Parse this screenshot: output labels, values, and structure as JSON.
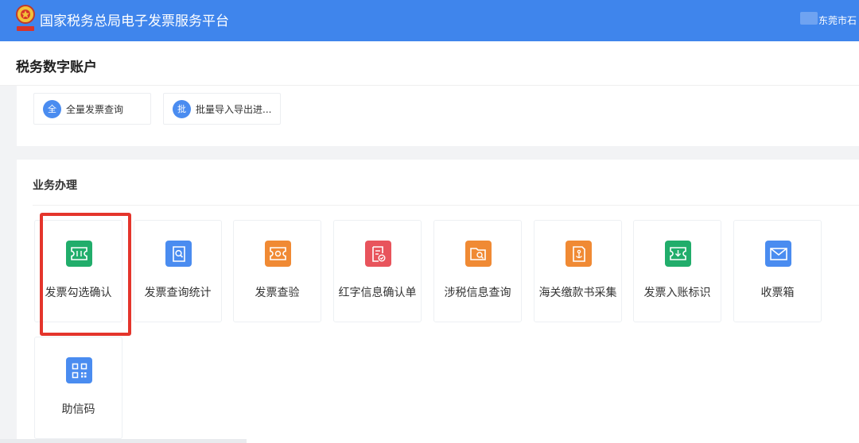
{
  "header": {
    "title": "国家税务总局电子发票服务平台",
    "user_area": "东莞市石"
  },
  "page": {
    "title": "税务数字账户"
  },
  "quick_actions": [
    {
      "badge": "全",
      "label": "全量发票查询"
    },
    {
      "badge": "批",
      "label": "批量导入导出进..."
    }
  ],
  "business": {
    "title": "业务办理",
    "tiles": [
      {
        "label": "发票勾选确认",
        "icon": "ticket-check-icon",
        "color": "#21ad6b",
        "highlighted": true
      },
      {
        "label": "发票查询统计",
        "icon": "search-doc-icon",
        "color": "#4a8cf0"
      },
      {
        "label": "发票查验",
        "icon": "ticket-icon",
        "color": "#f08a34"
      },
      {
        "label": "红字信息确认单",
        "icon": "doc-check-icon",
        "color": "#e8545c"
      },
      {
        "label": "涉税信息查询",
        "icon": "folder-search-icon",
        "color": "#f08a34"
      },
      {
        "label": "海关缴款书采集",
        "icon": "doc-anchor-icon",
        "color": "#f08a34"
      },
      {
        "label": "发票入账标识",
        "icon": "ticket-download-icon",
        "color": "#21ad6b"
      },
      {
        "label": "收票箱",
        "icon": "envelope-icon",
        "color": "#4a8cf0"
      },
      {
        "label": "助信码",
        "icon": "qr-code-icon",
        "color": "#4a8cf0"
      }
    ]
  },
  "colors": {
    "topbar": "#3f85ec",
    "highlight": "#e4352c"
  }
}
